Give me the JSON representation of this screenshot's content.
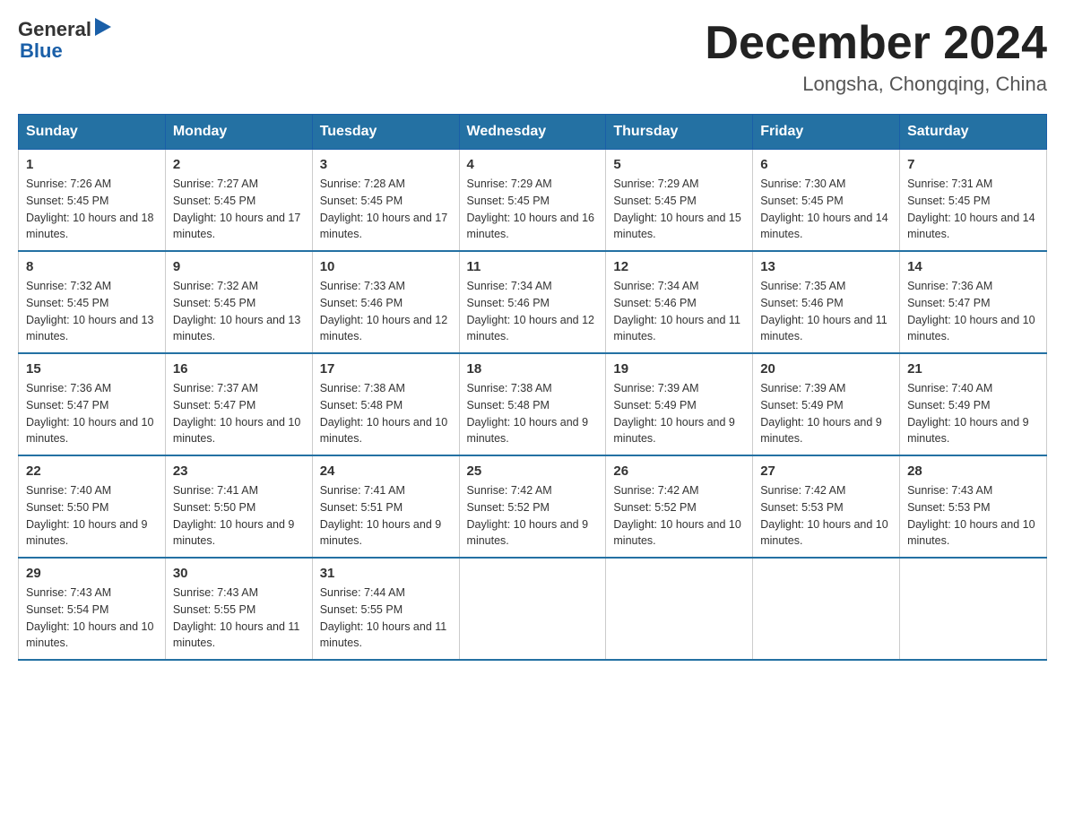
{
  "header": {
    "logo_general": "General",
    "logo_blue": "Blue",
    "month_year": "December 2024",
    "location": "Longsha, Chongqing, China"
  },
  "days_of_week": [
    "Sunday",
    "Monday",
    "Tuesday",
    "Wednesday",
    "Thursday",
    "Friday",
    "Saturday"
  ],
  "weeks": [
    [
      {
        "day": "1",
        "sunrise": "7:26 AM",
        "sunset": "5:45 PM",
        "daylight": "10 hours and 18 minutes."
      },
      {
        "day": "2",
        "sunrise": "7:27 AM",
        "sunset": "5:45 PM",
        "daylight": "10 hours and 17 minutes."
      },
      {
        "day": "3",
        "sunrise": "7:28 AM",
        "sunset": "5:45 PM",
        "daylight": "10 hours and 17 minutes."
      },
      {
        "day": "4",
        "sunrise": "7:29 AM",
        "sunset": "5:45 PM",
        "daylight": "10 hours and 16 minutes."
      },
      {
        "day": "5",
        "sunrise": "7:29 AM",
        "sunset": "5:45 PM",
        "daylight": "10 hours and 15 minutes."
      },
      {
        "day": "6",
        "sunrise": "7:30 AM",
        "sunset": "5:45 PM",
        "daylight": "10 hours and 14 minutes."
      },
      {
        "day": "7",
        "sunrise": "7:31 AM",
        "sunset": "5:45 PM",
        "daylight": "10 hours and 14 minutes."
      }
    ],
    [
      {
        "day": "8",
        "sunrise": "7:32 AM",
        "sunset": "5:45 PM",
        "daylight": "10 hours and 13 minutes."
      },
      {
        "day": "9",
        "sunrise": "7:32 AM",
        "sunset": "5:45 PM",
        "daylight": "10 hours and 13 minutes."
      },
      {
        "day": "10",
        "sunrise": "7:33 AM",
        "sunset": "5:46 PM",
        "daylight": "10 hours and 12 minutes."
      },
      {
        "day": "11",
        "sunrise": "7:34 AM",
        "sunset": "5:46 PM",
        "daylight": "10 hours and 12 minutes."
      },
      {
        "day": "12",
        "sunrise": "7:34 AM",
        "sunset": "5:46 PM",
        "daylight": "10 hours and 11 minutes."
      },
      {
        "day": "13",
        "sunrise": "7:35 AM",
        "sunset": "5:46 PM",
        "daylight": "10 hours and 11 minutes."
      },
      {
        "day": "14",
        "sunrise": "7:36 AM",
        "sunset": "5:47 PM",
        "daylight": "10 hours and 10 minutes."
      }
    ],
    [
      {
        "day": "15",
        "sunrise": "7:36 AM",
        "sunset": "5:47 PM",
        "daylight": "10 hours and 10 minutes."
      },
      {
        "day": "16",
        "sunrise": "7:37 AM",
        "sunset": "5:47 PM",
        "daylight": "10 hours and 10 minutes."
      },
      {
        "day": "17",
        "sunrise": "7:38 AM",
        "sunset": "5:48 PM",
        "daylight": "10 hours and 10 minutes."
      },
      {
        "day": "18",
        "sunrise": "7:38 AM",
        "sunset": "5:48 PM",
        "daylight": "10 hours and 9 minutes."
      },
      {
        "day": "19",
        "sunrise": "7:39 AM",
        "sunset": "5:49 PM",
        "daylight": "10 hours and 9 minutes."
      },
      {
        "day": "20",
        "sunrise": "7:39 AM",
        "sunset": "5:49 PM",
        "daylight": "10 hours and 9 minutes."
      },
      {
        "day": "21",
        "sunrise": "7:40 AM",
        "sunset": "5:49 PM",
        "daylight": "10 hours and 9 minutes."
      }
    ],
    [
      {
        "day": "22",
        "sunrise": "7:40 AM",
        "sunset": "5:50 PM",
        "daylight": "10 hours and 9 minutes."
      },
      {
        "day": "23",
        "sunrise": "7:41 AM",
        "sunset": "5:50 PM",
        "daylight": "10 hours and 9 minutes."
      },
      {
        "day": "24",
        "sunrise": "7:41 AM",
        "sunset": "5:51 PM",
        "daylight": "10 hours and 9 minutes."
      },
      {
        "day": "25",
        "sunrise": "7:42 AM",
        "sunset": "5:52 PM",
        "daylight": "10 hours and 9 minutes."
      },
      {
        "day": "26",
        "sunrise": "7:42 AM",
        "sunset": "5:52 PM",
        "daylight": "10 hours and 10 minutes."
      },
      {
        "day": "27",
        "sunrise": "7:42 AM",
        "sunset": "5:53 PM",
        "daylight": "10 hours and 10 minutes."
      },
      {
        "day": "28",
        "sunrise": "7:43 AM",
        "sunset": "5:53 PM",
        "daylight": "10 hours and 10 minutes."
      }
    ],
    [
      {
        "day": "29",
        "sunrise": "7:43 AM",
        "sunset": "5:54 PM",
        "daylight": "10 hours and 10 minutes."
      },
      {
        "day": "30",
        "sunrise": "7:43 AM",
        "sunset": "5:55 PM",
        "daylight": "10 hours and 11 minutes."
      },
      {
        "day": "31",
        "sunrise": "7:44 AM",
        "sunset": "5:55 PM",
        "daylight": "10 hours and 11 minutes."
      },
      null,
      null,
      null,
      null
    ]
  ],
  "labels": {
    "sunrise": "Sunrise:",
    "sunset": "Sunset:",
    "daylight": "Daylight:"
  }
}
